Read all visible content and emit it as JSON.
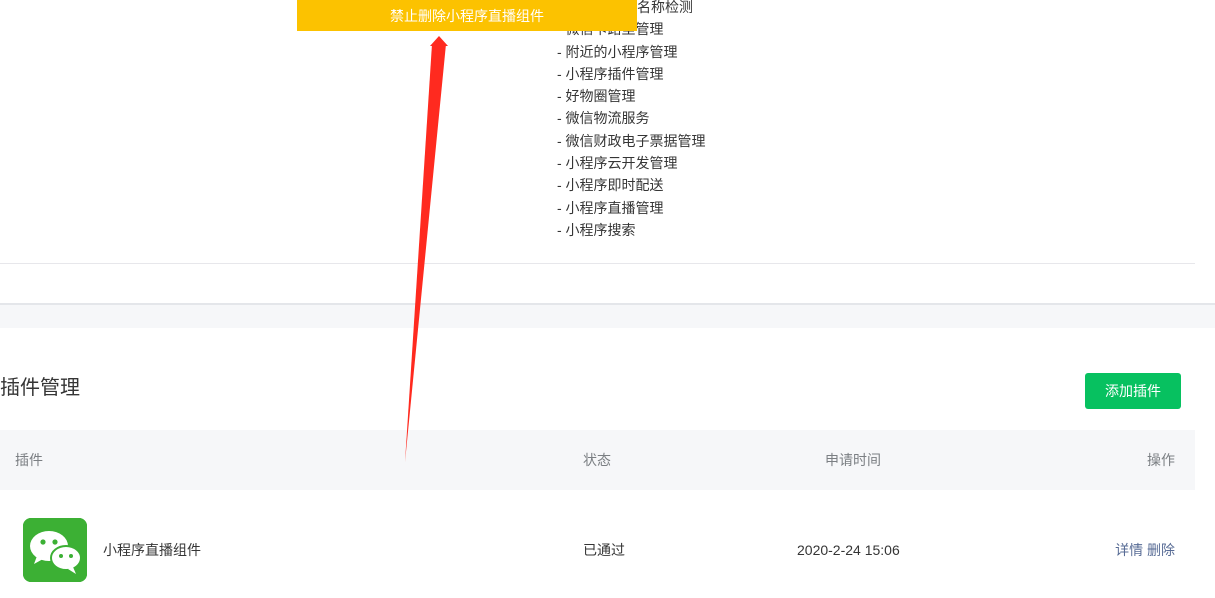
{
  "annotation": {
    "banner_text": "禁止删除小程序直播组件",
    "banner_color": "#fcc200",
    "arrow_color": "#ff2a1f"
  },
  "permissions": {
    "partial_first": "名称检测",
    "items": [
      "- 微信卡路里管理",
      "- 附近的小程序管理",
      "- 小程序插件管理",
      "- 好物圈管理",
      "- 微信物流服务",
      "- 微信财政电子票据管理",
      "- 小程序云开发管理",
      "- 小程序即时配送",
      "- 小程序直播管理",
      "- 小程序搜索"
    ]
  },
  "plugin_section": {
    "title": "插件管理",
    "add_button_label": "添加插件",
    "accent_color": "#07c160",
    "columns": {
      "plugin": "插件",
      "status": "状态",
      "applied_time": "申请时间",
      "actions": "操作"
    },
    "rows": [
      {
        "icon": "wechat-icon",
        "name": "小程序直播组件",
        "status": "已通过",
        "applied_time": "2020-2-24 15:06",
        "action_detail": "详情",
        "action_delete": "删除"
      }
    ]
  }
}
